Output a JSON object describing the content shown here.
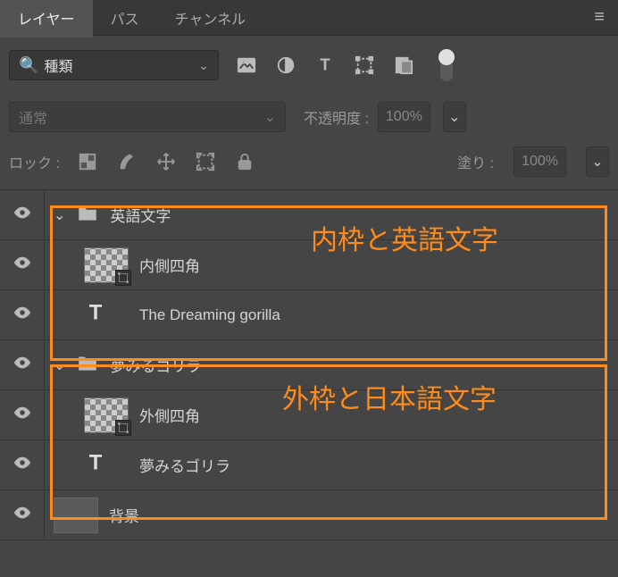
{
  "tabs": {
    "layers": "レイヤー",
    "paths": "パス",
    "channels": "チャンネル"
  },
  "filter": {
    "label": "種類"
  },
  "blend": {
    "mode": "通常",
    "opacity_label": "不透明度 :",
    "opacity_value": "100%"
  },
  "lock": {
    "label": "ロック :",
    "fill_label": "塗り :",
    "fill_value": "100%"
  },
  "groups": [
    {
      "name": "英語文字",
      "layers": [
        {
          "name": "内側四角",
          "type": "smart"
        },
        {
          "name": "The Dreaming gorilla",
          "type": "text"
        }
      ]
    },
    {
      "name": "夢みるゴリラ",
      "layers": [
        {
          "name": "外側四角",
          "type": "smart"
        },
        {
          "name": "夢みるゴリラ",
          "type": "text"
        }
      ]
    }
  ],
  "bg_layer": "背景",
  "annotations": {
    "label1": "内枠と英語文字",
    "label2": "外枠と日本語文字"
  }
}
